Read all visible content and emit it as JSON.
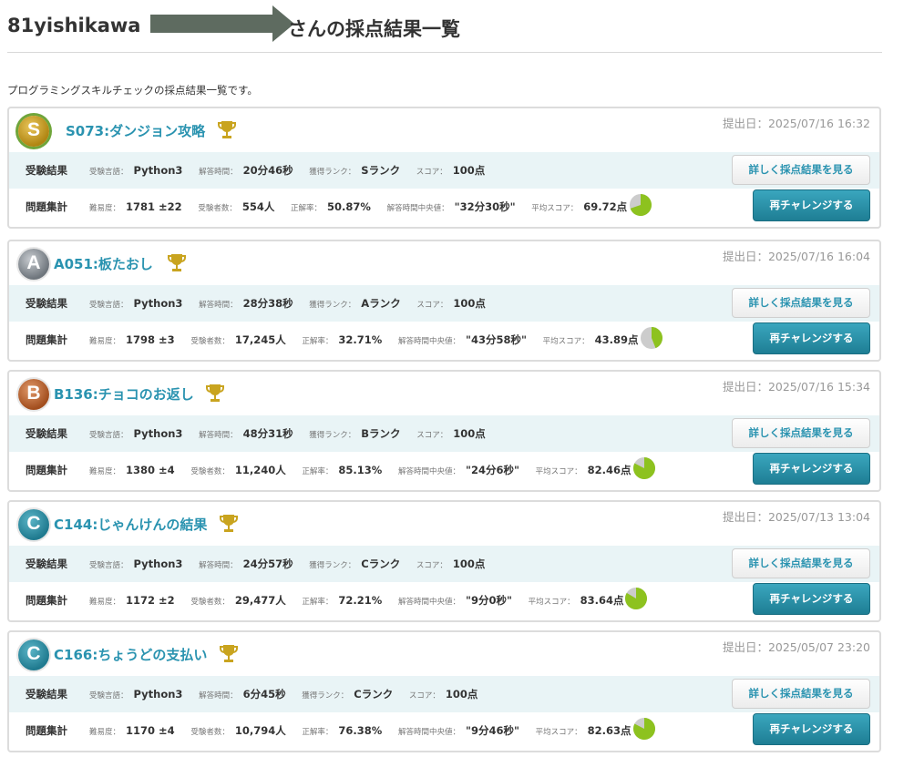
{
  "header": {
    "title_prefix": "81yishikawa",
    "title_suffix": "さんの採点結果一覧"
  },
  "intro": "プログラミングスキルチェックの採点結果一覧です。",
  "labels": {
    "result_row": "受験結果",
    "stats_row": "問題集計",
    "language": "受験言語：",
    "answer_time": "解答時間：",
    "rank": "獲得ランク：",
    "score": "スコア：",
    "difficulty": "難易度：",
    "examinees": "受験者数：",
    "accuracy": "正解率：",
    "median_time": "解答時間中央値：",
    "avg_score": "平均スコア："
  },
  "buttons": {
    "detail": "詳しく採点結果を見る",
    "retry": "再チャレンジする"
  },
  "colors": {
    "accent": "#2a93b0",
    "result_row_bg": "#e9f4f6",
    "pie_fill": "#8dc21f",
    "pie_bg": "#cccccc"
  },
  "results": [
    {
      "rank_letter": "S",
      "title": "S073:ダンジョン攻略",
      "submitted": "提出日：2025/07/16 16:32",
      "language": "Python3",
      "answer_time": "20分46秒",
      "rank": "Sランク",
      "score": "100点",
      "difficulty": "1781 ±22",
      "examinees": "554人",
      "accuracy": "50.87%",
      "median_time": "\"32分30秒\"",
      "avg_score": "69.72点",
      "avg_score_fraction": 0.697
    },
    {
      "rank_letter": "A",
      "title": "A051:板たおし",
      "submitted": "提出日：2025/07/16 16:04",
      "language": "Python3",
      "answer_time": "28分38秒",
      "rank": "Aランク",
      "score": "100点",
      "difficulty": "1798 ±3",
      "examinees": "17,245人",
      "accuracy": "32.71%",
      "median_time": "\"43分58秒\"",
      "avg_score": "43.89点",
      "avg_score_fraction": 0.439
    },
    {
      "rank_letter": "B",
      "title": "B136:チョコのお返し",
      "submitted": "提出日：2025/07/16 15:34",
      "language": "Python3",
      "answer_time": "48分31秒",
      "rank": "Bランク",
      "score": "100点",
      "difficulty": "1380 ±4",
      "examinees": "11,240人",
      "accuracy": "85.13%",
      "median_time": "\"24分6秒\"",
      "avg_score": "82.46点",
      "avg_score_fraction": 0.825
    },
    {
      "rank_letter": "C",
      "title": "C144:じゃんけんの結果",
      "submitted": "提出日：2025/07/13 13:04",
      "language": "Python3",
      "answer_time": "24分57秒",
      "rank": "Cランク",
      "score": "100点",
      "difficulty": "1172 ±2",
      "examinees": "29,477人",
      "accuracy": "72.21%",
      "median_time": "\"9分0秒\"",
      "avg_score": "83.64点",
      "avg_score_fraction": 0.836
    },
    {
      "rank_letter": "C",
      "title": "C166:ちょうどの支払い",
      "submitted": "提出日：2025/05/07 23:20",
      "language": "Python3",
      "answer_time": "6分45秒",
      "rank": "Cランク",
      "score": "100点",
      "difficulty": "1170 ±4",
      "examinees": "10,794人",
      "accuracy": "76.38%",
      "median_time": "\"9分46秒\"",
      "avg_score": "82.63点",
      "avg_score_fraction": 0.826
    }
  ]
}
